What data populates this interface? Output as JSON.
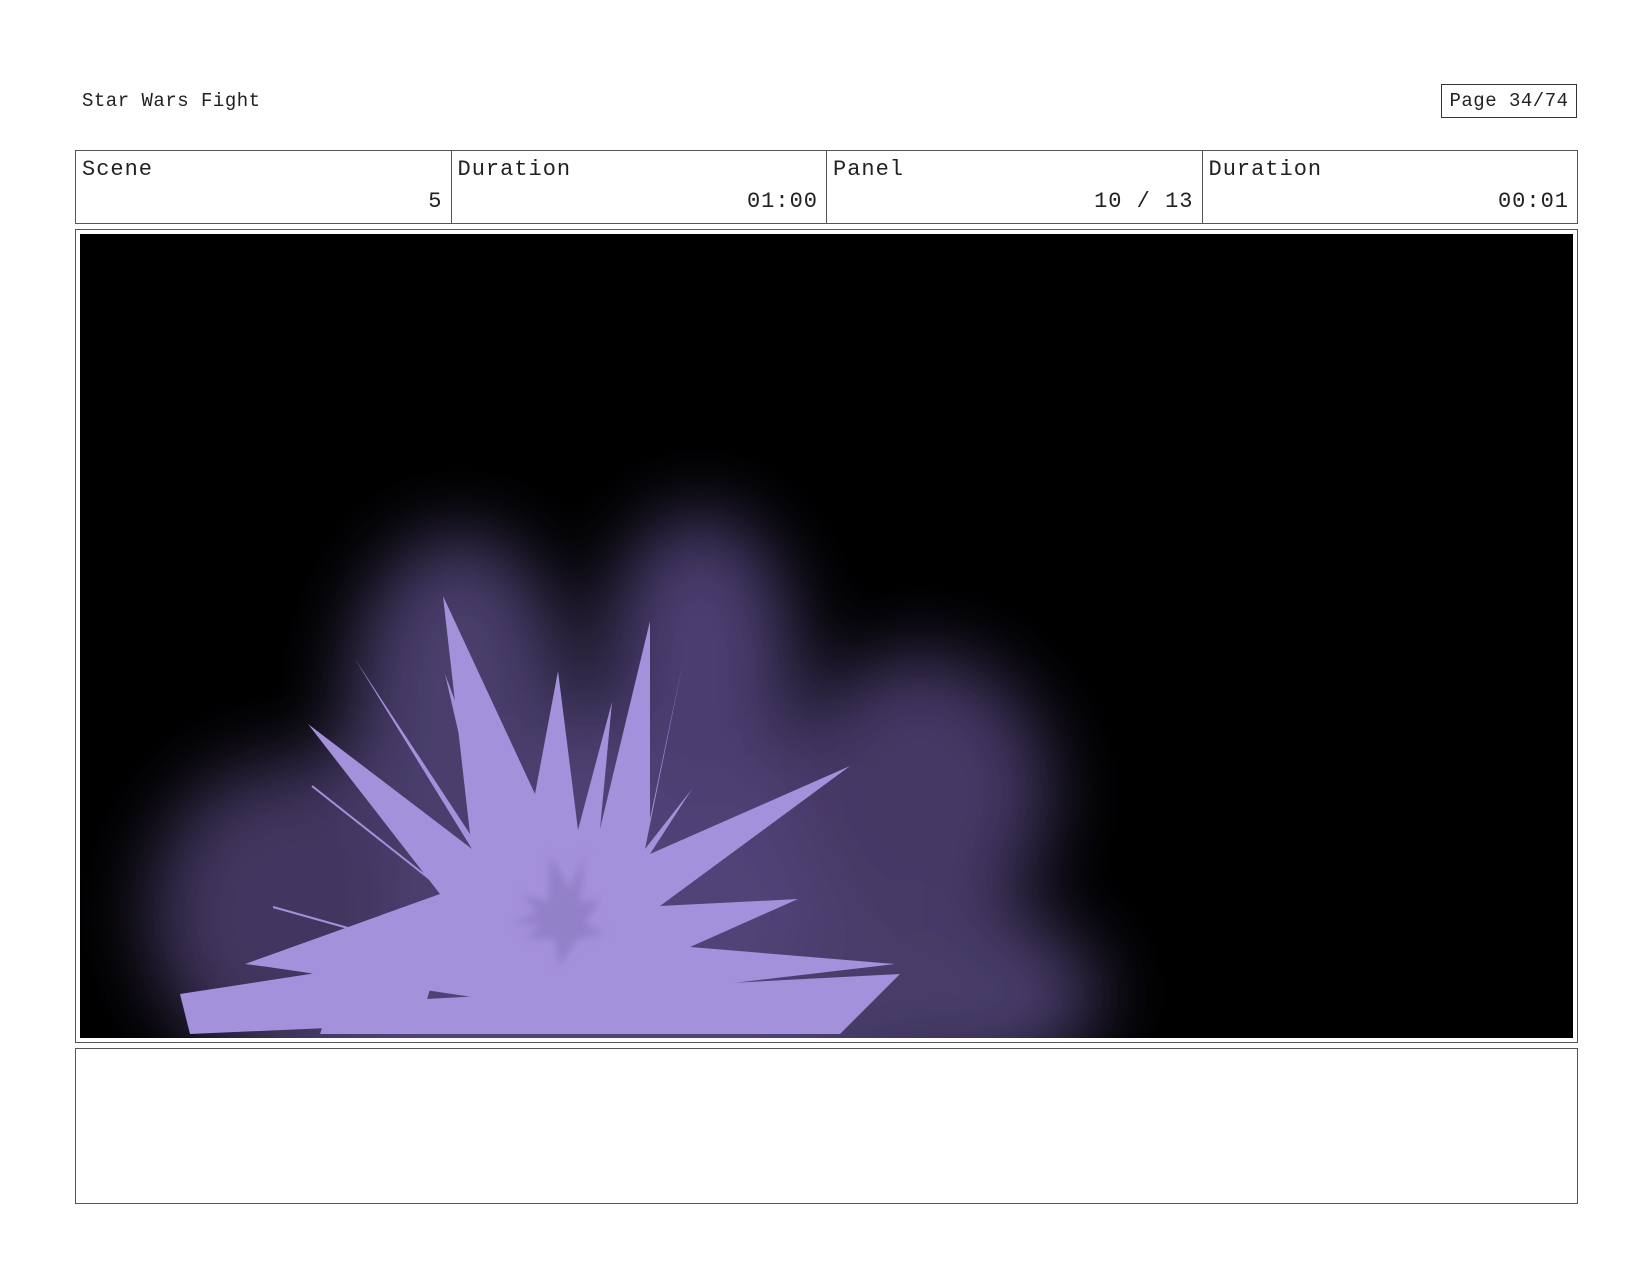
{
  "header": {
    "title": "Star Wars Fight",
    "page_label": "Page 34/74"
  },
  "info": [
    {
      "label": "Scene",
      "value": "5"
    },
    {
      "label": "Duration",
      "value": "01:00"
    },
    {
      "label": "Panel",
      "value": "10 / 13"
    },
    {
      "label": "Duration",
      "value": "00:01"
    }
  ],
  "panel": {
    "background_color": "#000000",
    "glow_color": "#6e5c9e",
    "burst_color": "#a491dc",
    "core_color": "#9280c8"
  },
  "notes": {
    "text": ""
  }
}
